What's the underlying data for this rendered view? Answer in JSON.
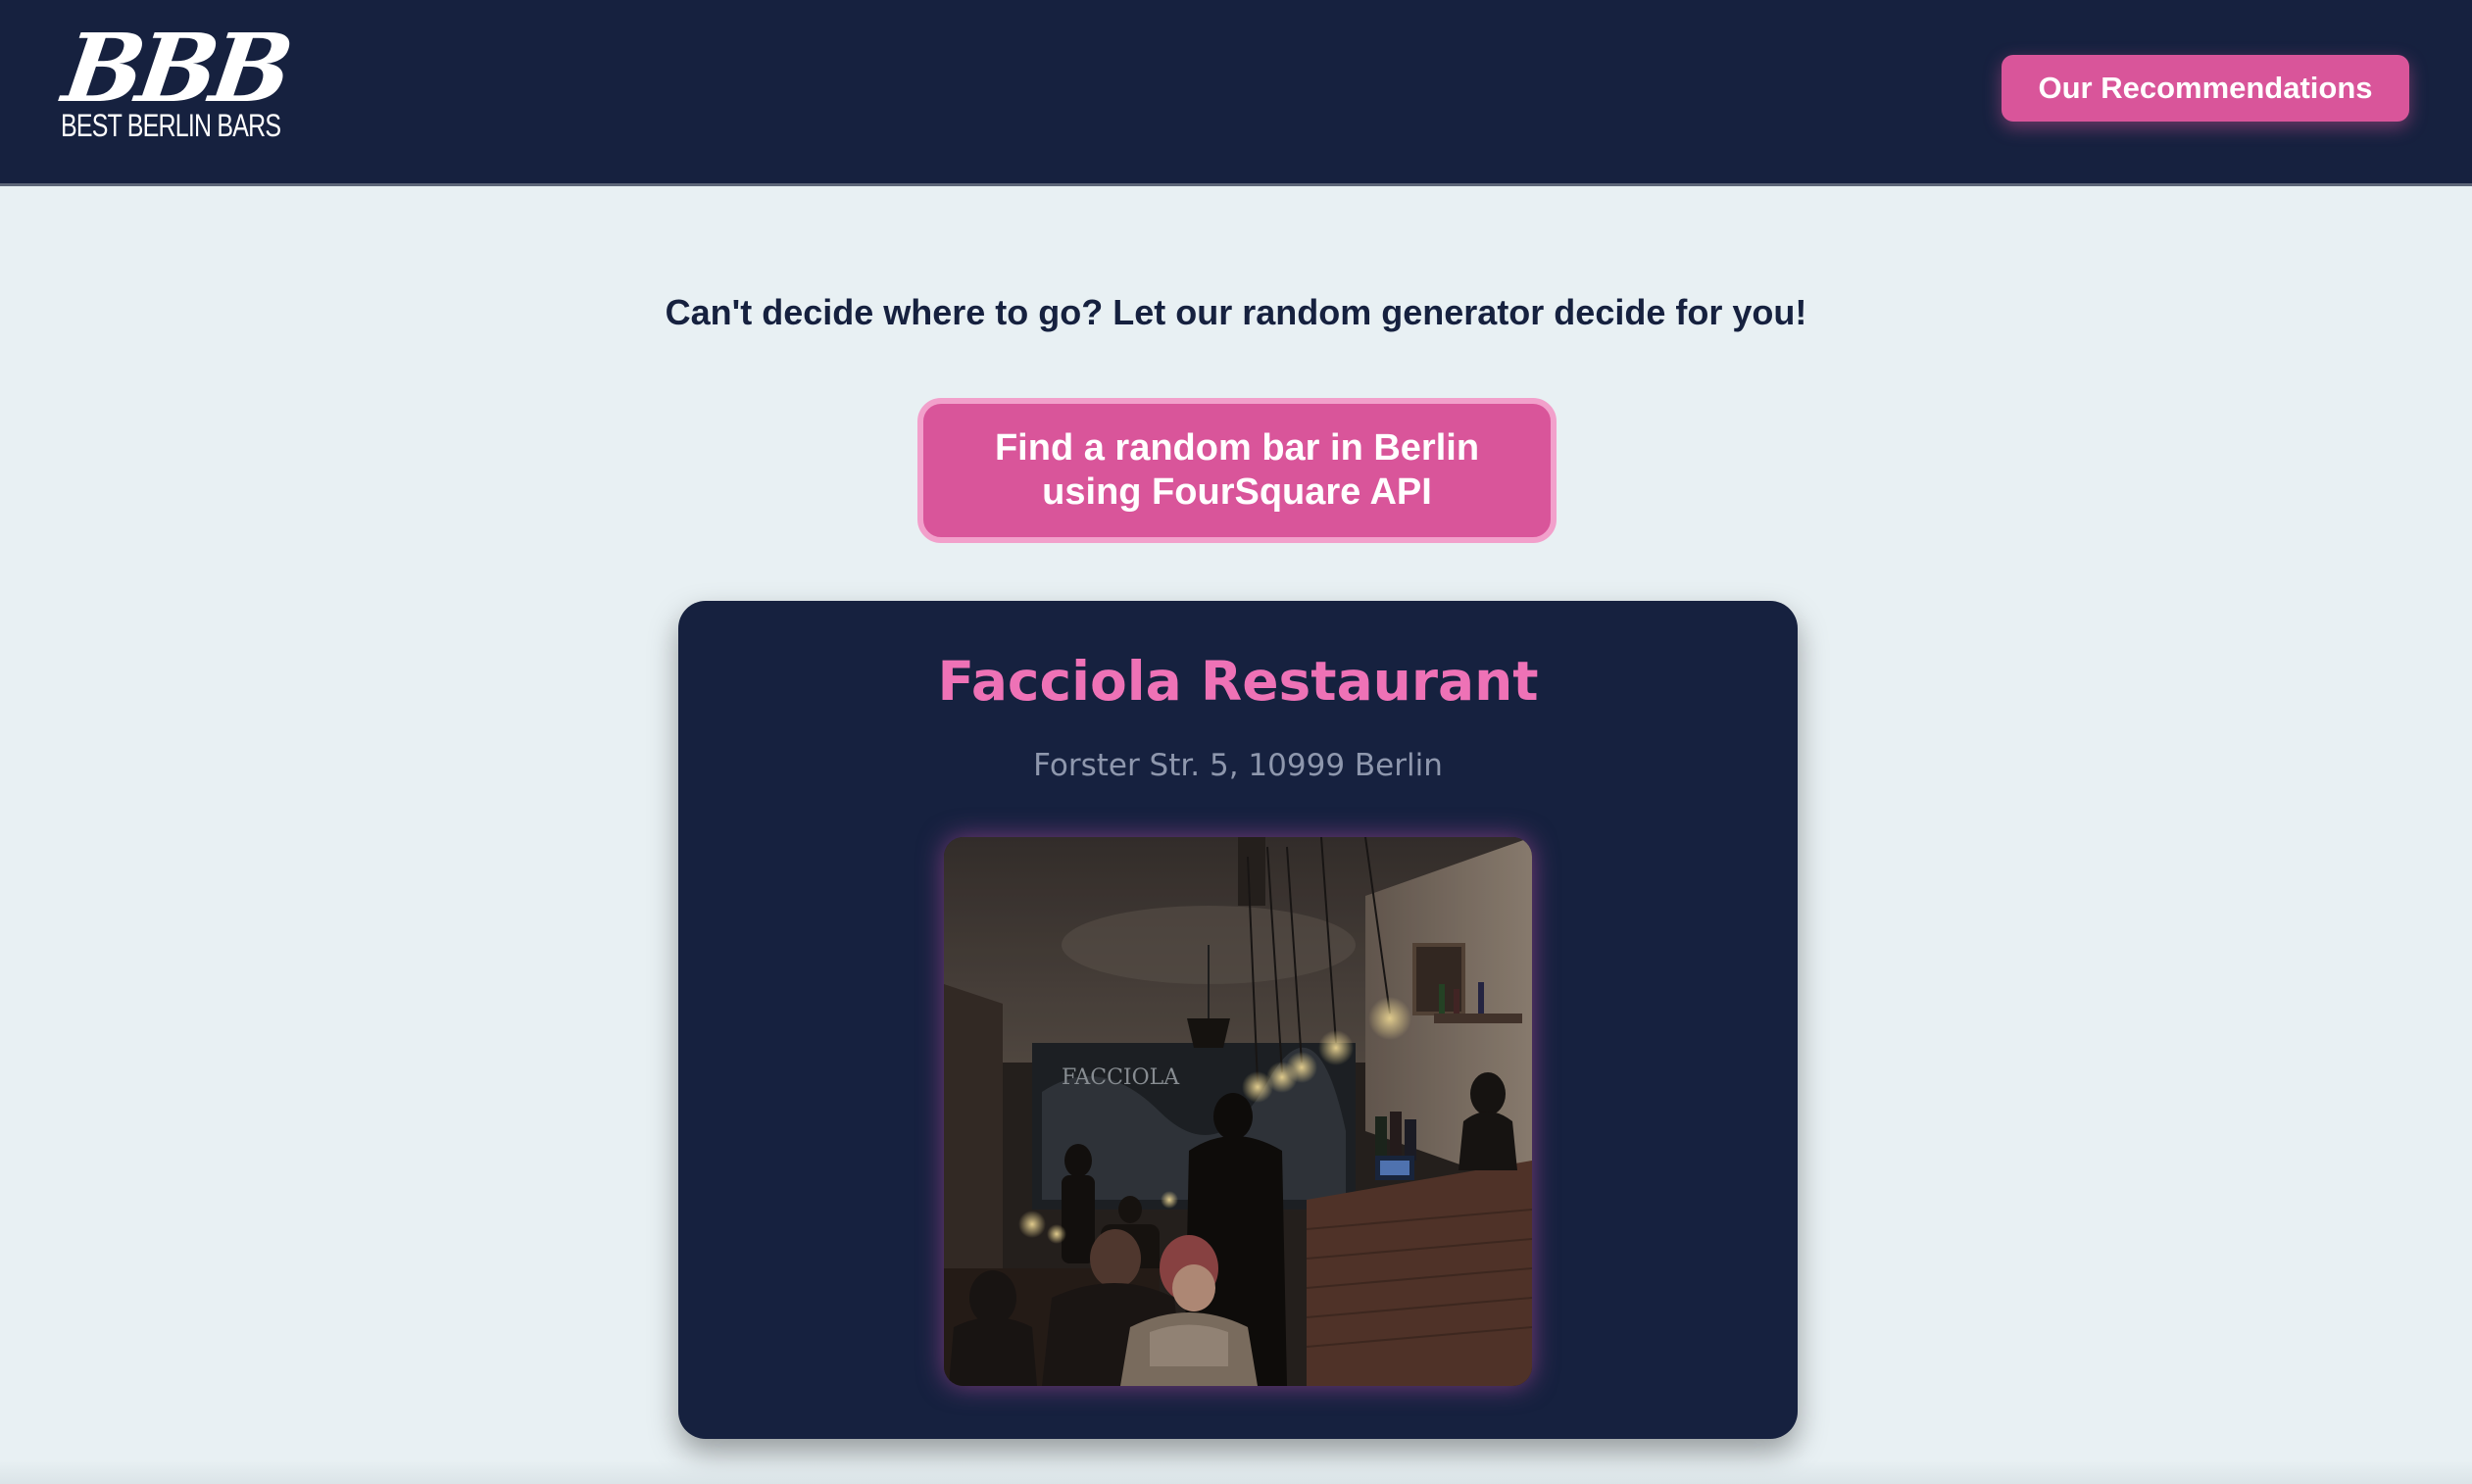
{
  "header": {
    "logo_mark": "BBB",
    "logo_text": "BEST BERLIN BARS",
    "recommendations_label": "Our Recommendations"
  },
  "main": {
    "tagline": "Can't decide where to go? Let our random generator decide for you!",
    "random_button_label": "Find a random bar in Berlin using FourSquare API"
  },
  "result": {
    "name": "Facciola Restaurant",
    "address": "Forster Str. 5, 10999 Berlin",
    "photo_alt": "Interior photo of Facciola Restaurant",
    "photo_sign": "FACCIOLA"
  },
  "colors": {
    "header_bg": "#16213f",
    "page_bg": "#e8f0f3",
    "accent_pink": "#d9559a",
    "title_pink": "#ee72b6",
    "address_gray": "#8e97ad"
  }
}
